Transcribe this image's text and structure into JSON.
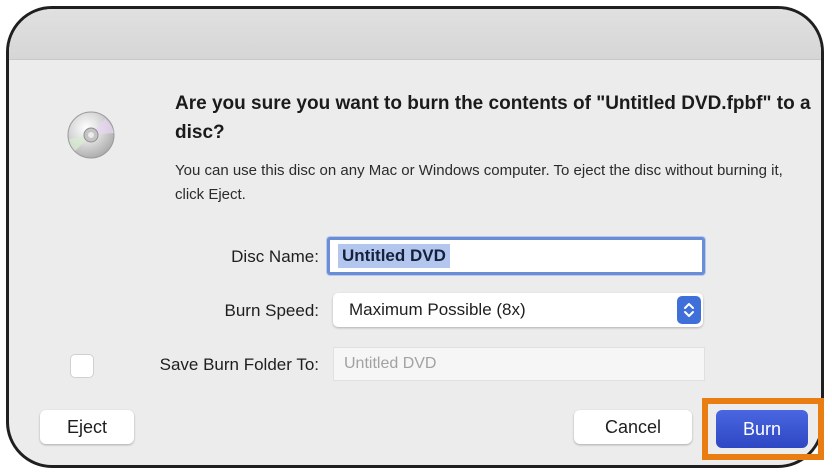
{
  "dialog": {
    "headline": "Are you sure you want to burn the contents of \"Untitled DVD.fpbf\" to a disc?",
    "info": "You can use this disc on any Mac or Windows computer. To eject the disc without burning it, click Eject.",
    "disc_name_label": "Disc Name:",
    "disc_name_value": "Untitled DVD",
    "burn_speed_label": "Burn Speed:",
    "burn_speed_value": "Maximum Possible (8x)",
    "save_folder_label": "Save Burn Folder To:",
    "save_folder_placeholder": "Untitled DVD",
    "save_folder_checked": false
  },
  "buttons": {
    "eject": "Eject",
    "cancel": "Cancel",
    "burn": "Burn"
  },
  "icons": {
    "disc": "disc-icon",
    "stepper": "chevron-updown-icon"
  },
  "colors": {
    "accent": "#3f6fd9",
    "highlight": "#e97d12"
  }
}
